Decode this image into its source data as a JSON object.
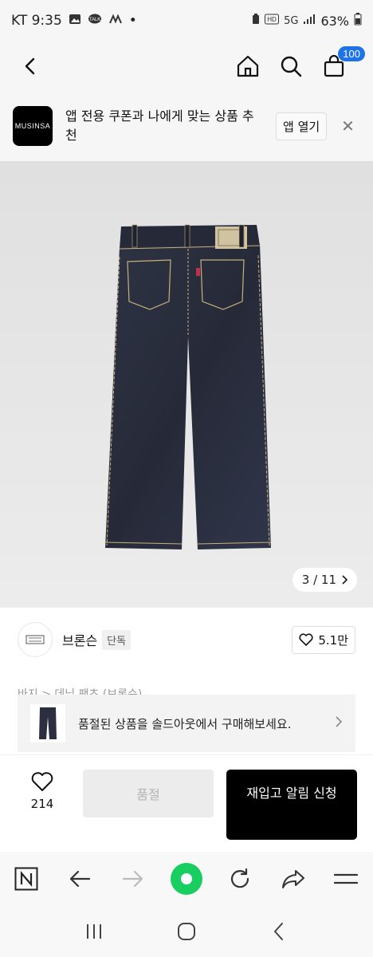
{
  "status_bar": {
    "carrier_time": "KT 9:35",
    "dot": "•",
    "battery": "63%",
    "network": "5G"
  },
  "nav": {
    "cart_badge": "100"
  },
  "app_banner": {
    "logo_text": "MUSINSA",
    "message": "앱 전용 쿠폰과 나에게 맞는 상품 추천",
    "open_button": "앱 열기",
    "close_icon": "✕"
  },
  "gallery": {
    "counter": "3 / 11"
  },
  "brand": {
    "name": "브론슨",
    "tag": "단독",
    "likes": "5.1만"
  },
  "breadcrumb_cut": "바지 > 데님 팬츠 (브론슨)",
  "soldout_banner": {
    "text": "품절된 상품을 솔드아웃에서 구매해보세요."
  },
  "action_bar": {
    "wish_count": "214",
    "soldout_label": "품절",
    "restock_label": "재입고 알림 신청"
  },
  "colors": {
    "accent_blue": "#1f73e8",
    "naver_green": "#19ce60",
    "denim": "#2b2f3f"
  }
}
